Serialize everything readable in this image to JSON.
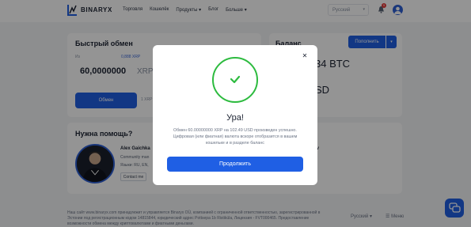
{
  "header": {
    "logo_text": "BINARYX",
    "nav": [
      "Торговля",
      "Кошелёк",
      "Продукты",
      "Блог",
      "Больше"
    ],
    "language": "Русский",
    "notifications_count": "9"
  },
  "exchange": {
    "title": "Быстрый обмен",
    "from_label": "Из",
    "balance": "0,888 XRP",
    "amount": "60,0000000",
    "currency": "XRP",
    "button": "Обмен",
    "rate": "1 XRP"
  },
  "balance": {
    "title": "Баланс",
    "topup_button": "Пополнить",
    "btc_value": "34 BTC",
    "usd_value": "SD"
  },
  "help": {
    "title": "Нужна помощь?",
    "name": "Alex Gaichka",
    "role": "Community man",
    "languages": "Языки: RU, EN,",
    "contact_button": "Contact me",
    "name2": "tov"
  },
  "footer": {
    "text": "Наш сайт www.binaryx.com принадлежит и управляется Binaryx OÜ, компанией с ограниченной ответственностью, зарегистрированной в Эстонии под регистрационным кодом 14815844, юридический адрес Pottsepa 1b Ristiküla, Лицензия - FVT000465. Предоставление возможности обмена между криптовалютами и фиатными деньгами.",
    "language": "Русский",
    "menu": "Меню"
  },
  "modal": {
    "title": "Ура!",
    "description": "Обмен 60.00000000 XRP на 102.49 USD произведен успешно. Цифровая (или фиатная) валюта вскоре отобразится в вашем кошельке и в разделе баланс",
    "continue_button": "Продолжить"
  }
}
